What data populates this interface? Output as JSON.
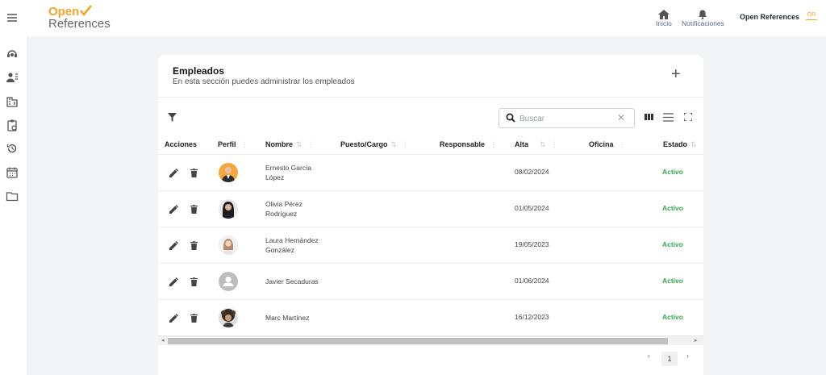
{
  "sidebar": {
    "icons": [
      "menu-icon",
      "support-agent-icon",
      "employees-icon",
      "company-icon",
      "clipboard-icon",
      "history-icon",
      "calendar-icon",
      "folder-icon"
    ]
  },
  "logo": {
    "line1": "Open",
    "line2": "References"
  },
  "topnav": {
    "home_label": "Inicio",
    "notifications_label": "Notificaciones",
    "user_name": "Open References",
    "user_badge": "OR"
  },
  "card": {
    "title": "Empleados",
    "subtitle": "En esta sección puedes administrar los empleados",
    "add_symbol": "+"
  },
  "search": {
    "placeholder": "Buscar",
    "value": ""
  },
  "columns": [
    "Acciones",
    "Perfil",
    "Nombre",
    "Puesto/Cargo",
    "Responsable",
    "Alta",
    "Oficina",
    "Estado"
  ],
  "rows": [
    {
      "name_l1": "Ernesto García",
      "name_l2": "López",
      "puesto": "",
      "responsable": "",
      "alta": "08/02/2024",
      "oficina": "",
      "estado": "Activo",
      "avatar": "photo-man-suit"
    },
    {
      "name_l1": "Olivia Pérez",
      "name_l2": "Rodríguez",
      "puesto": "",
      "responsable": "",
      "alta": "01/05/2024",
      "oficina": "",
      "estado": "Activo",
      "avatar": "photo-woman-dark"
    },
    {
      "name_l1": "Laura Hernández",
      "name_l2": "González",
      "puesto": "",
      "responsable": "",
      "alta": "19/05/2023",
      "oficina": "",
      "estado": "Activo",
      "avatar": "photo-woman-light"
    },
    {
      "name_l1": "Javier Secaduras",
      "name_l2": "",
      "puesto": "",
      "responsable": "",
      "alta": "01/06/2024",
      "oficina": "",
      "estado": "Activo",
      "avatar": "default-person-icon"
    },
    {
      "name_l1": "Marc Martínez",
      "name_l2": "",
      "puesto": "",
      "responsable": "",
      "alta": "16/12/2023",
      "oficina": "",
      "estado": "Activo",
      "avatar": "photo-curly-hair"
    }
  ],
  "pagination": {
    "prev": "‹",
    "current": "1",
    "next": "›"
  },
  "colors": {
    "accent": "#f5a524",
    "status_active": "#34a853"
  }
}
